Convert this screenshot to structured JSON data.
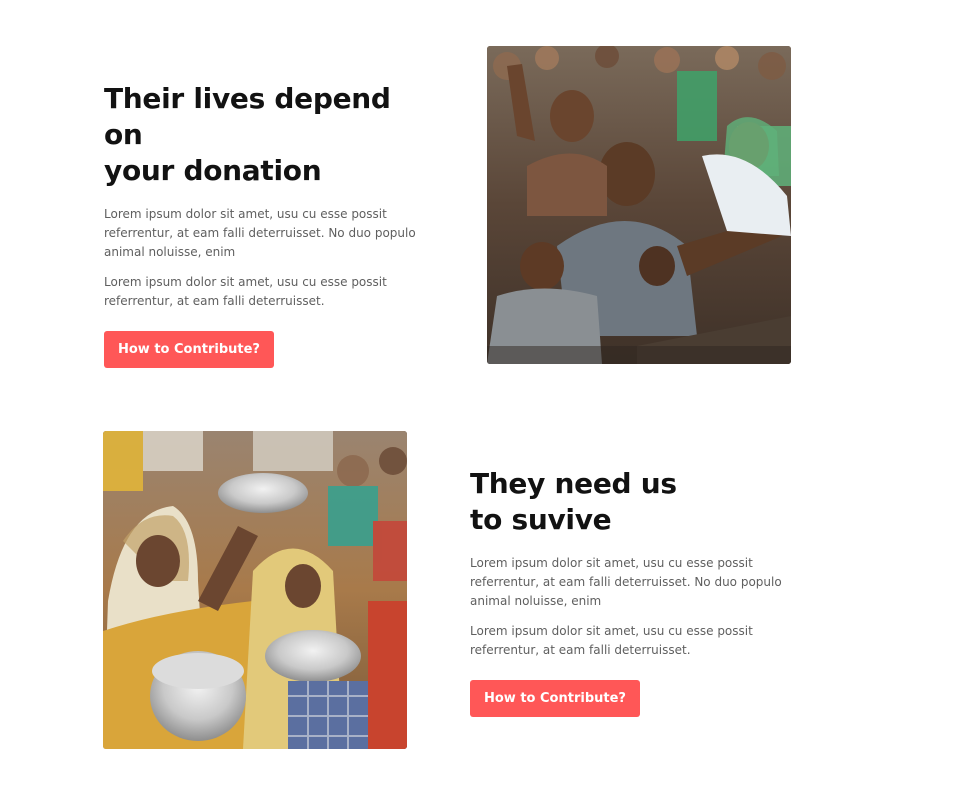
{
  "sections": [
    {
      "heading_lines": [
        "Their lives depend on",
        "your donation"
      ],
      "paragraphs": [
        "Lorem ipsum dolor sit amet, usu cu esse possit referrentur, at eam falli deterruisset. No duo populo animal noluisse, enim",
        "Lorem ipsum dolor sit amet, usu cu esse possit referrentur, at eam falli deterruisset."
      ],
      "button_label": "How to Contribute?",
      "image_name": "crowd-reaching-photo"
    },
    {
      "heading_lines": [
        "They need us",
        "to suvive"
      ],
      "paragraphs": [
        "Lorem ipsum dolor sit amet, usu cu esse possit referrentur, at eam falli deterruisset. No duo populo animal noluisse, enim",
        "Lorem ipsum dolor sit amet, usu cu esse possit referrentur, at eam falli deterruisset."
      ],
      "button_label": "How to Contribute?",
      "image_name": "women-holding-bowls-photo"
    }
  ],
  "colors": {
    "accent": "#ff5757",
    "heading": "#121212",
    "body_text": "#5f5f5f",
    "background": "#ffffff"
  }
}
